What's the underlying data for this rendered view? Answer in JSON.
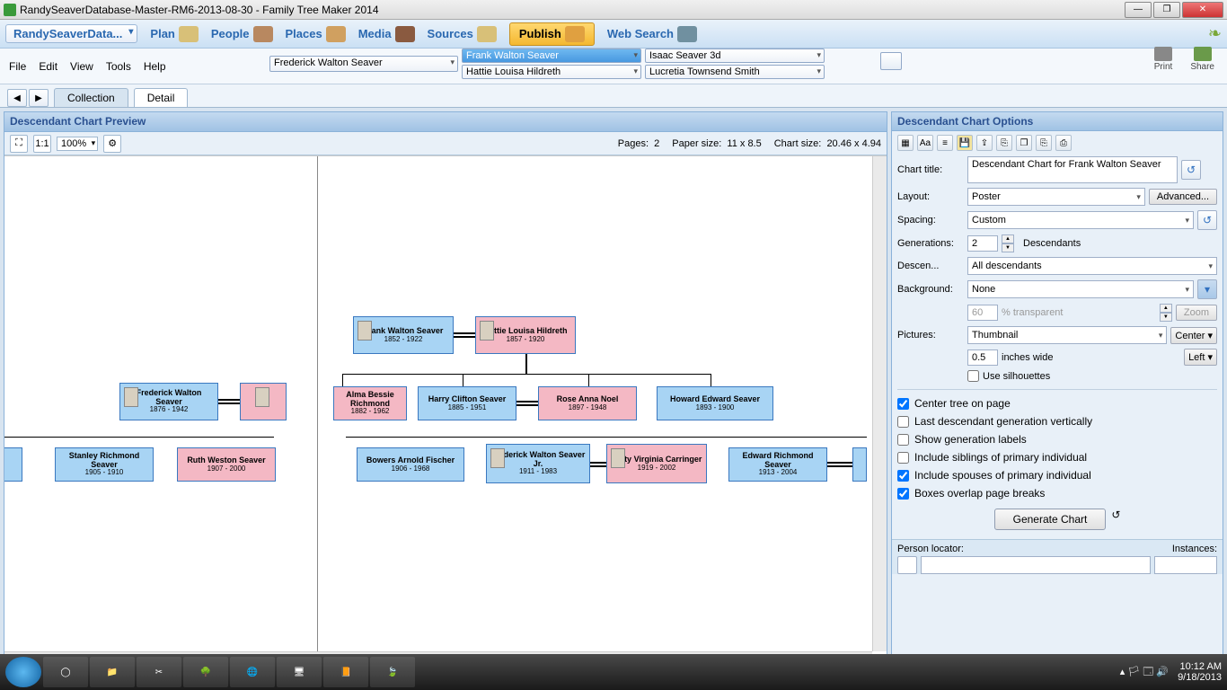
{
  "titlebar": {
    "text": "RandySeaverDatabase-Master-RM6-2013-08-30 - Family Tree Maker 2014"
  },
  "maintoolbar": {
    "db": "RandySeaverData...",
    "plan": "Plan",
    "people": "People",
    "places": "Places",
    "media": "Media",
    "sources": "Sources",
    "publish": "Publish",
    "websearch": "Web Search"
  },
  "menubar": {
    "file": "File",
    "edit": "Edit",
    "view": "View",
    "tools": "Tools",
    "help": "Help",
    "print": "Print",
    "share": "Share",
    "ped1": "Frederick Walton Seaver",
    "ped2": "Frank Walton Seaver",
    "ped3": "Hattie Louisa Hildreth",
    "ped4": "Isaac Seaver 3d",
    "ped5": "Lucretia Townsend Smith"
  },
  "tabs": {
    "collection": "Collection",
    "detail": "Detail"
  },
  "preview": {
    "title": "Descendant Chart Preview",
    "zoom": "100%",
    "pages_lbl": "Pages:",
    "pages": "2",
    "paper_lbl": "Paper size:",
    "paper": "11 x 8.5",
    "chart_lbl": "Chart size:",
    "chart": "20.46 x 4.94"
  },
  "people": {
    "frank": {
      "name": "Frank Walton Seaver",
      "dates": "1852 - 1922"
    },
    "hattie": {
      "name": "Hattie Louisa Hildreth",
      "dates": "1857 - 1920"
    },
    "fred": {
      "name": "Frederick Walton Seaver",
      "dates": "1876 - 1942"
    },
    "alma": {
      "name": "Alma Bessie Richmond",
      "dates": "1882 - 1962"
    },
    "harry": {
      "name": "Harry Clifton Seaver",
      "dates": "1885 - 1951"
    },
    "rose": {
      "name": "Rose Anna Noel",
      "dates": "1897 - 1948"
    },
    "howard": {
      "name": "Howard Edward Seaver",
      "dates": "1893 - 1900"
    },
    "stanley": {
      "name": "Stanley Richmond Seaver",
      "dates": "1905 - 1910"
    },
    "ruth": {
      "name": "Ruth Weston Seaver",
      "dates": "1907 - 2000"
    },
    "bowers": {
      "name": "Bowers Arnold Fischer",
      "dates": "1906 - 1968"
    },
    "fredjr": {
      "name": "Frederick Walton Seaver Jr.",
      "dates": "1911 - 1983"
    },
    "betty": {
      "name": "Betty Virginia Carringer",
      "dates": "1919 - 2002"
    },
    "edward": {
      "name": "Edward Richmond Seaver",
      "dates": "1913 - 2004"
    }
  },
  "options": {
    "title": "Descendant Chart Options",
    "charttitle_lbl": "Chart title:",
    "charttitle": "Descendant Chart for Frank Walton Seaver",
    "layout_lbl": "Layout:",
    "layout": "Poster",
    "advanced": "Advanced...",
    "spacing_lbl": "Spacing:",
    "spacing": "Custom",
    "gens_lbl": "Generations:",
    "gens": "2",
    "gens_txt": "Descendants",
    "descen_lbl": "Descen...",
    "descen": "All descendants",
    "bg_lbl": "Background:",
    "bg": "None",
    "transp": "60",
    "transp_lbl": "% transparent",
    "zoom": "Zoom",
    "pics_lbl": "Pictures:",
    "pics": "Thumbnail",
    "center": "Center",
    "width": "0.5",
    "width_lbl": "inches wide",
    "left": "Left",
    "silh": "Use silhouettes",
    "chk1": "Center tree on page",
    "chk2": "Last descendant generation vertically",
    "chk3": "Show generation labels",
    "chk4": "Include siblings of primary individual",
    "chk5": "Include spouses of primary individual",
    "chk6": "Boxes overlap page breaks",
    "generate": "Generate Chart",
    "locator": "Person locator:",
    "instances": "Instances:"
  },
  "taskbar": {
    "time": "10:12 AM",
    "date": "9/18/2013"
  }
}
